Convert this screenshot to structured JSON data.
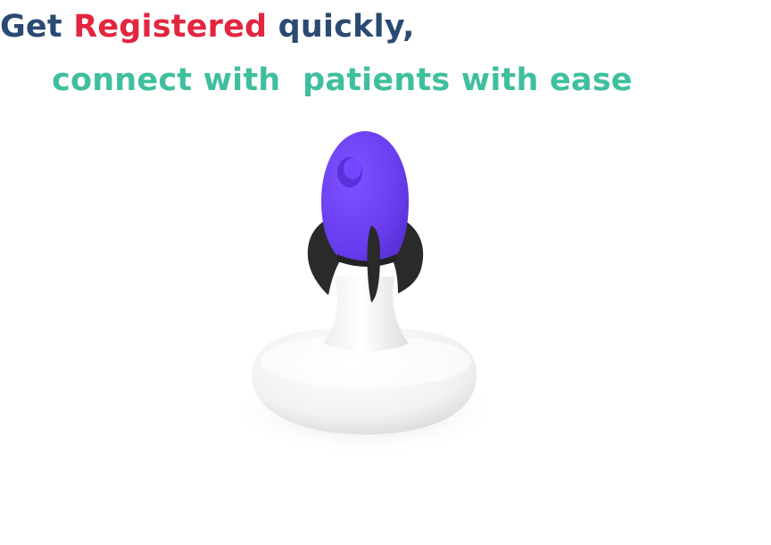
{
  "headline": {
    "part1": "Get ",
    "part2": "Registered",
    "part3": " quickly,"
  },
  "subline": {
    "text": "connect with  patients with ease"
  },
  "colors": {
    "navy": "#2b4a73",
    "red": "#e3263f",
    "teal": "#3fbf9f",
    "rocket_purple": "#6a3ef0",
    "fin_black": "#2a2a2a"
  },
  "illustration": {
    "icon": "rocket-on-stand-icon"
  }
}
